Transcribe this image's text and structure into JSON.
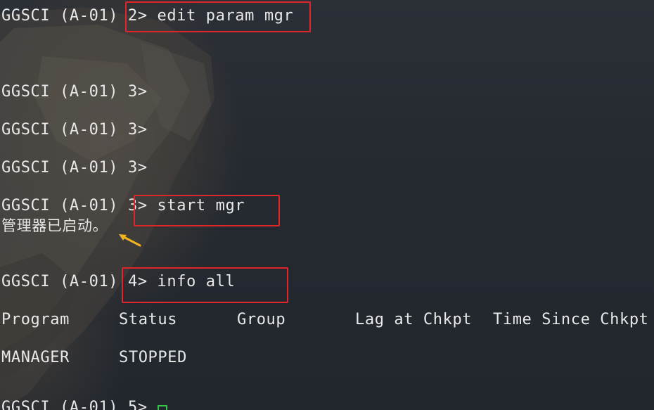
{
  "terminal": {
    "lines": {
      "l1_prompt": "GGSCI (A-01) ",
      "l1_cmd": "2> edit param mgr",
      "l2": "GGSCI (A-01) 3>",
      "l3": "GGSCI (A-01) 3>",
      "l4": "GGSCI (A-01) 3>",
      "l5_prompt": "GGSCI (A-01) 3",
      "l5_cmd": "> start mgr",
      "l6": "管理器已启动。",
      "l7_prompt": "GGSCI (A-01) ",
      "l7_cmd": "4> info all",
      "l8": "GGSCI (A-01) 5>"
    },
    "table": {
      "headers": [
        "Program",
        "Status",
        "Group",
        "Lag at Chkpt",
        "Time Since Chkpt"
      ],
      "row": [
        "MANAGER",
        "STOPPED"
      ]
    },
    "colors": {
      "text": "#e8e8e8",
      "highlight_border": "#e0262b",
      "cursor": "#39c24a",
      "arrow": "#f2b320"
    }
  }
}
